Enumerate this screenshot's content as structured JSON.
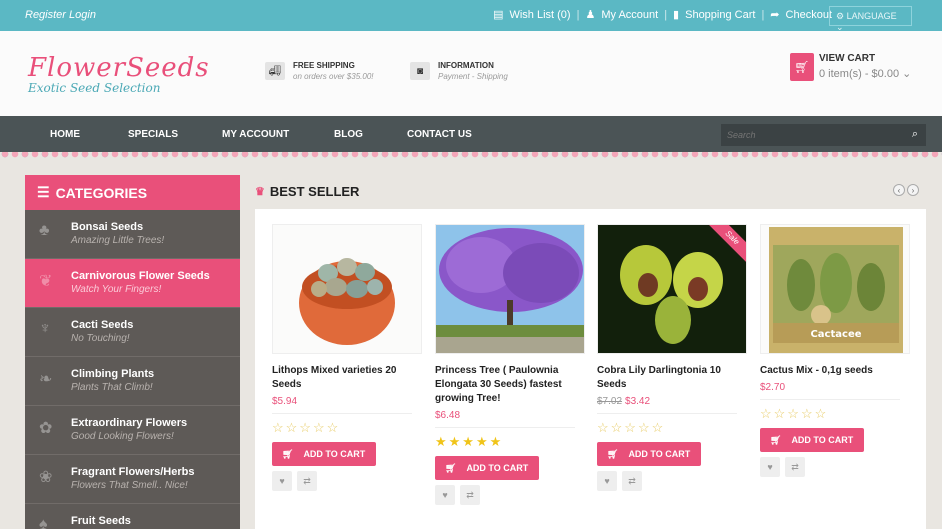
{
  "topbar": {
    "register": "Register Login",
    "wishlist": "Wish List (0)",
    "account": "My Account",
    "cart": "Shopping Cart",
    "checkout": "Checkout",
    "language": "LANGUAGE"
  },
  "header": {
    "logo_main": "FlowerSeeds",
    "logo_sub": "Exotic Seed Selection",
    "shipping_title": "FREE SHIPPING",
    "shipping_sub": "on orders over $35.00!",
    "info_title": "INFORMATION",
    "info_sub": "Payment - Shipping",
    "cart_title": "VIEW CART",
    "cart_summary": "0 item(s) - $0.00"
  },
  "nav": {
    "items": [
      "HOME",
      "SPECIALS",
      "MY ACCOUNT",
      "BLOG",
      "CONTACT US"
    ],
    "search_placeholder": "Search"
  },
  "sidebar": {
    "title": "CATEGORIES",
    "items": [
      {
        "name": "Bonsai Seeds",
        "sub": "Amazing Little Trees!"
      },
      {
        "name": "Carnivorous Flower Seeds",
        "sub": "Watch Your Fingers!"
      },
      {
        "name": "Cacti Seeds",
        "sub": "No Touching!"
      },
      {
        "name": "Climbing Plants",
        "sub": "Plants That Climb!"
      },
      {
        "name": "Extraordinary Flowers",
        "sub": "Good Looking Flowers!"
      },
      {
        "name": "Fragrant Flowers/Herbs",
        "sub": "Flowers That Smell.. Nice!"
      },
      {
        "name": "Fruit Seeds",
        "sub": ""
      }
    ]
  },
  "section": {
    "title": "BEST SELLER"
  },
  "products": [
    {
      "name": "Lithops Mixed varieties 20 Seeds",
      "price": "$5.94",
      "old_price": "",
      "stars": "☆☆☆☆☆",
      "add": "ADD TO CART"
    },
    {
      "name": "Princess Tree ( Paulownia Elongata 30 Seeds) fastest growing Tree!",
      "price": "$6.48",
      "old_price": "",
      "stars": "★★★★★",
      "add": "ADD TO CART"
    },
    {
      "name": "Cobra Lily Darlingtonia 10 Seeds",
      "price": "$3.42",
      "old_price": "$7.02",
      "stars": "☆☆☆☆☆",
      "add": "ADD TO CART",
      "ribbon": "Sale"
    },
    {
      "name": "Cactus Mix - 0,1g seeds",
      "price": "$2.70",
      "old_price": "",
      "stars": "☆☆☆☆☆",
      "add": "ADD TO CART",
      "img_label": "Cactacee"
    }
  ],
  "colors": {
    "accent": "#e9507a",
    "teal": "#5bb8c4",
    "nav": "#4b5456"
  }
}
